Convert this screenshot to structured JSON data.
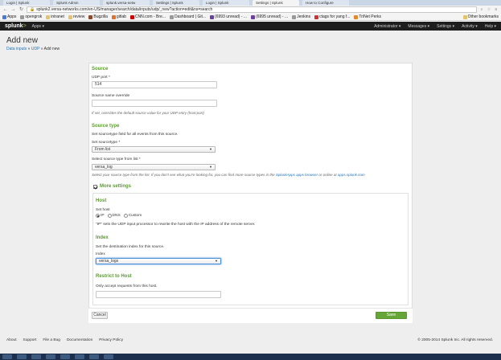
{
  "browser": {
    "tabs": [
      "Login | Splunk",
      "Splunk Admin",
      "splunk.versa-netw",
      "Settings | Splunk",
      "Login | Splunk",
      "Settings | Splunk",
      "How to Configure"
    ],
    "url": "splunk2.versa-networks.com/en-US/manager/search/data/inputs/udp/_new?action=edit&ns=search",
    "bookmarks": [
      "Apps",
      "opengrok",
      "intranet",
      "review",
      "Bugzilla",
      "gitlab",
      "CNN.com - Bre...",
      "Dashboard | Git...",
      "(6993 unread) - ...",
      "(6995 unread) - ...",
      "Jenkins",
      "ctags for yang f...",
      "TriNet Perks"
    ],
    "other_bookmarks": "Other bookmarks"
  },
  "splunkbar": {
    "logo": "splunk",
    "logo_suffix": ">",
    "apps": "Apps ▾",
    "menu": [
      "Administrator ▾",
      "Messages ▾",
      "Settings ▾",
      "Activity ▾",
      "Help ▾"
    ]
  },
  "header": {
    "title": "Add new",
    "breadcrumb_1": "Data inputs",
    "sep": " » ",
    "breadcrumb_2": "UDP",
    "breadcrumb_3": "Add new"
  },
  "form": {
    "source_heading": "Source",
    "udp_port_label": "UDP port *",
    "udp_port_value": "514",
    "source_name_label": "Source name override",
    "source_name_value": "",
    "source_name_help": "If set, overrides the default source value for your UDP entry (host:port)",
    "sourcetype_heading": "Source type",
    "sourcetype_help": "Set sourcetype field for all events from this source.",
    "set_sourcetype_label": "Set sourcetype *",
    "set_sourcetype_value": "From list",
    "select_from_list_label": "Select source type from list *",
    "select_from_list_value": "versa_log",
    "list_help_prefix": "Select your source type from the list. If you don't see what you're looking for, you can find more source types in the ",
    "list_help_link1": "SplunkApps apps browser",
    "list_help_mid": " or online at ",
    "list_help_link2": "apps.splunk.com",
    "more_settings": "More settings",
    "host_heading": "Host",
    "set_host_label": "Set host",
    "host_options": [
      "IP",
      "DNS",
      "Custom"
    ],
    "host_help": "\"IP\" sets the UDP input processor to rewrite the host with the IP address of the remote server.",
    "index_heading": "Index",
    "index_help": "Set the destination index for this source.",
    "index_label": "Index",
    "index_value": "versa_logs",
    "restrict_heading": "Restrict to Host",
    "restrict_help": "Only accept requests from this host.",
    "restrict_value": "",
    "cancel": "Cancel",
    "save": "Save"
  },
  "footer": {
    "links": [
      "About",
      "Support",
      "File a Bug",
      "Documentation",
      "Privacy Policy"
    ],
    "copyright": "© 2005-2014 Splunk Inc. All rights reserved."
  },
  "colors": {
    "accent_green": "#65a637",
    "section_green": "#5c9b2f",
    "link_blue": "#1e73be",
    "splunkbar": "#1e1e1e"
  }
}
